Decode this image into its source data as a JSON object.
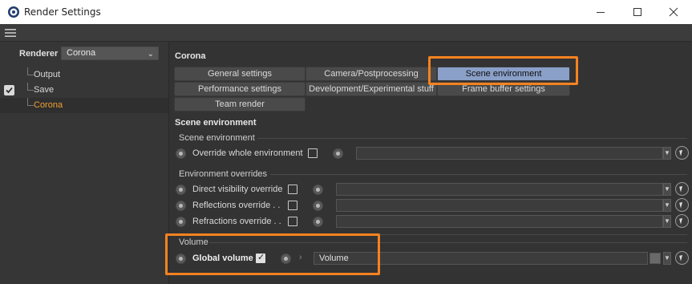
{
  "window": {
    "title": "Render Settings",
    "controls": [
      "minimize-icon",
      "maximize-icon",
      "close-icon"
    ]
  },
  "left": {
    "renderer_label": "Renderer",
    "renderer_value": "Corona",
    "tree": [
      {
        "label": "Output",
        "checked": false,
        "selected": false
      },
      {
        "label": "Save",
        "checked": true,
        "selected": false
      },
      {
        "label": "Corona",
        "checked": false,
        "selected": true
      }
    ]
  },
  "main": {
    "title": "Corona",
    "tabs": [
      {
        "label": "General settings",
        "active": false
      },
      {
        "label": "Camera/Postprocessing",
        "active": false
      },
      {
        "label": "Scene environment",
        "active": true
      },
      {
        "label": "Performance settings",
        "active": false
      },
      {
        "label": "Development/Experimental stuff",
        "active": false
      },
      {
        "label": "Frame buffer settings",
        "active": false
      },
      {
        "label": "Team render",
        "active": false
      }
    ],
    "section_title": "Scene environment",
    "groups": {
      "scene_env": {
        "label": "Scene environment",
        "rows": [
          {
            "label": "Override whole environment",
            "checked": false,
            "value": ""
          }
        ]
      },
      "env_overrides": {
        "label": "Environment overrides",
        "rows": [
          {
            "label": "Direct visibility override",
            "checked": false,
            "value": ""
          },
          {
            "label": "Reflections override  . .",
            "checked": false,
            "value": ""
          },
          {
            "label": "Refractions override  . .",
            "checked": false,
            "value": ""
          }
        ]
      },
      "volume": {
        "label": "Volume",
        "rows": [
          {
            "label": "Global volume",
            "checked": true,
            "value": "Volume"
          }
        ]
      }
    }
  },
  "colors": {
    "accent_active_tab": "#8aa0c8",
    "annotation": "#f58220",
    "selected_tree_text": "#f0a030"
  }
}
